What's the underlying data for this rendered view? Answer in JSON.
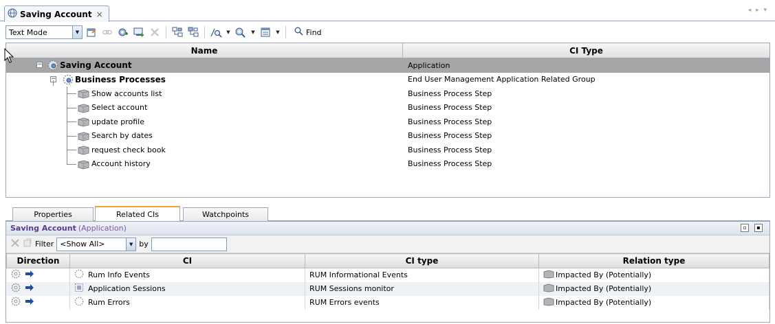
{
  "window": {
    "tab_title": "Saving Account",
    "tab_close": "×",
    "tab_nav": "◂ ▸ ▾"
  },
  "toolbar": {
    "mode_select": "Text Mode",
    "find_label": "Find"
  },
  "tree": {
    "columns": [
      "Name",
      "CI Type"
    ],
    "rows": [
      {
        "name": "Saving Account",
        "type": "Application",
        "level": 0,
        "bold": true,
        "selected": true
      },
      {
        "name": "Business Processes",
        "type": "End User Management Application Related Group",
        "level": 1,
        "bold": true,
        "selected": false
      },
      {
        "name": "Show accounts list",
        "type": "Business Process Step",
        "level": 2,
        "bold": false,
        "selected": false
      },
      {
        "name": "Select account",
        "type": "Business Process Step",
        "level": 2,
        "bold": false,
        "selected": false
      },
      {
        "name": "update profile",
        "type": "Business Process Step",
        "level": 2,
        "bold": false,
        "selected": false
      },
      {
        "name": "Search by dates",
        "type": "Business Process Step",
        "level": 2,
        "bold": false,
        "selected": false
      },
      {
        "name": "request check book",
        "type": "Business Process Step",
        "level": 2,
        "bold": false,
        "selected": false
      },
      {
        "name": "Account history",
        "type": "Business Process Step",
        "level": 2,
        "bold": false,
        "selected": false
      }
    ]
  },
  "bottom_tabs": [
    {
      "label": "Properties",
      "active": false
    },
    {
      "label": "Related CIs",
      "active": true
    },
    {
      "label": "Watchpoints",
      "active": false
    }
  ],
  "related": {
    "title_name": "Saving Account",
    "title_type": "(Application)",
    "filter_label": "Filter",
    "filter_value": "<Show All>",
    "by_label": "by",
    "columns": [
      "Direction",
      "CI",
      "CI type",
      "Relation type"
    ],
    "rows": [
      {
        "ci": "Rum Info Events",
        "ci_type": "RUM Informational Events",
        "relation": "Impacted By (Potentially)"
      },
      {
        "ci": "Application Sessions",
        "ci_type": "RUM Sessions monitor",
        "relation": "Impacted By (Potentially)"
      },
      {
        "ci": "Rum Errors",
        "ci_type": "RUM Errors events",
        "relation": "Impacted By (Potentially)"
      }
    ]
  },
  "colors": {
    "selection": "#a6a6a6",
    "active_tab_accent": "#f0a030",
    "panel_title_text": "#5a3a8a"
  },
  "icons": {
    "tab": "globe-icon",
    "toolbar": [
      "properties-icon",
      "link-icon",
      "add-ci-icon",
      "add-related-icon",
      "delete-icon",
      "expand-icon",
      "collapse-icon",
      "zoom-icon",
      "search-ci-icon",
      "layout-icon",
      "find-icon"
    ],
    "tree": [
      "expander-icon",
      "business-process-icon",
      "step-icon"
    ]
  }
}
